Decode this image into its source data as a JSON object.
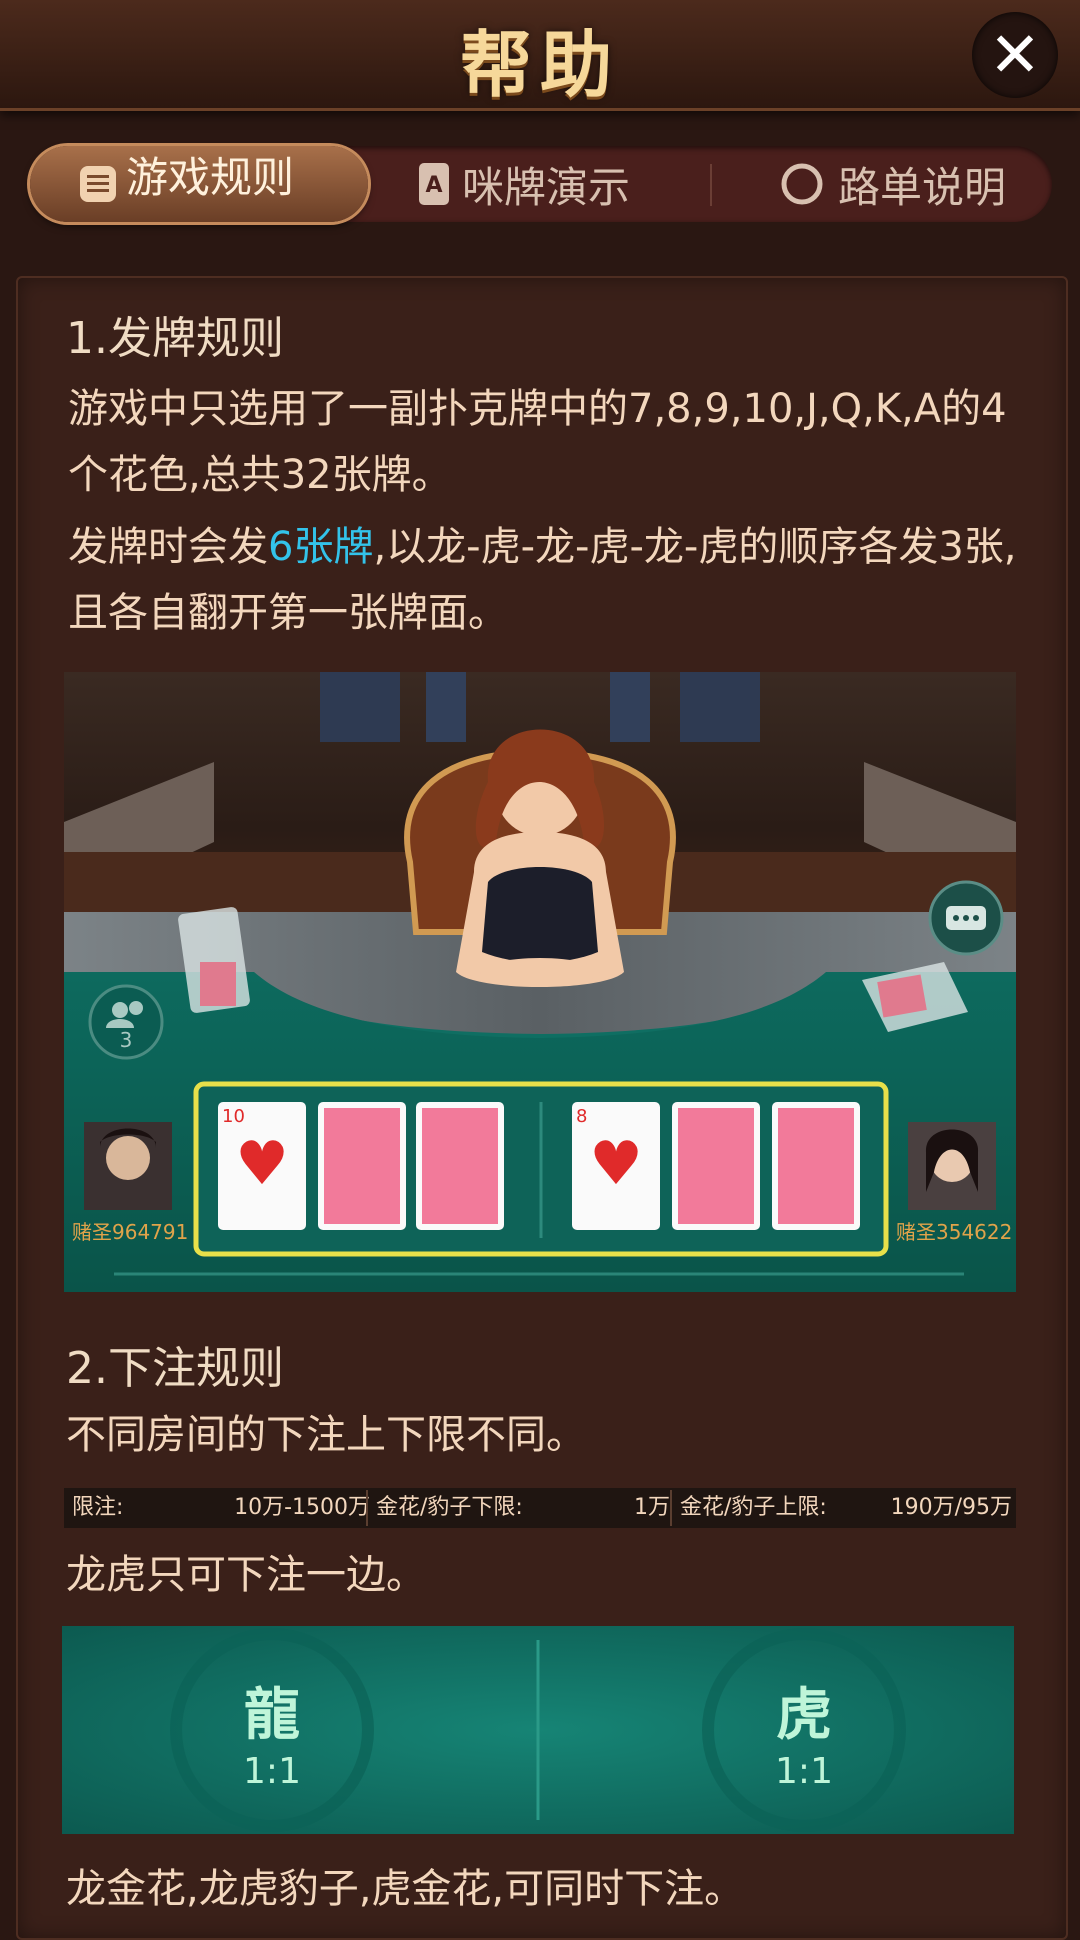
{
  "header": {
    "title": "帮助",
    "close_label": "✕"
  },
  "tabs": [
    {
      "label": "游戏规则",
      "icon": "list-icon",
      "active": true
    },
    {
      "label": "咪牌演示",
      "icon": "card-icon",
      "active": false
    },
    {
      "label": "路单说明",
      "icon": "circle-icon",
      "active": false
    }
  ],
  "section1": {
    "heading": "1.发牌规则",
    "para1": "游戏中只选用了一副扑克牌中的7,8,9,10,J,Q,K,A的4个花色,总共32张牌。",
    "para2_before": "发牌时会发",
    "para2_highlight": "6张牌",
    "para2_after": ",以龙-虎-龙-虎-龙-虎的顺序各发3张,且各自翻开第一张牌面。",
    "highlight_color": "#33c3ea"
  },
  "scene": {
    "player_count": "3",
    "left_player": "赌圣964791",
    "right_player": "赌圣354622",
    "left_card_rank": "10",
    "right_card_rank": "8",
    "card_suit": "♥"
  },
  "section2": {
    "heading": "2.下注规则",
    "para1": "不同房间的下注上下限不同。",
    "limits": [
      {
        "label": "限注:",
        "value": "10万-1500万"
      },
      {
        "label": "金花/豹子下限:",
        "value": "1万"
      },
      {
        "label": "金花/豹子上限:",
        "value": "190万/95万"
      }
    ],
    "para2": "龙虎只可下注一边。",
    "dragon": {
      "label": "龍",
      "odds": "1:1"
    },
    "tiger": {
      "label": "虎",
      "odds": "1:1"
    },
    "para3": "龙金花,龙虎豹子,虎金花,可同时下注。"
  }
}
